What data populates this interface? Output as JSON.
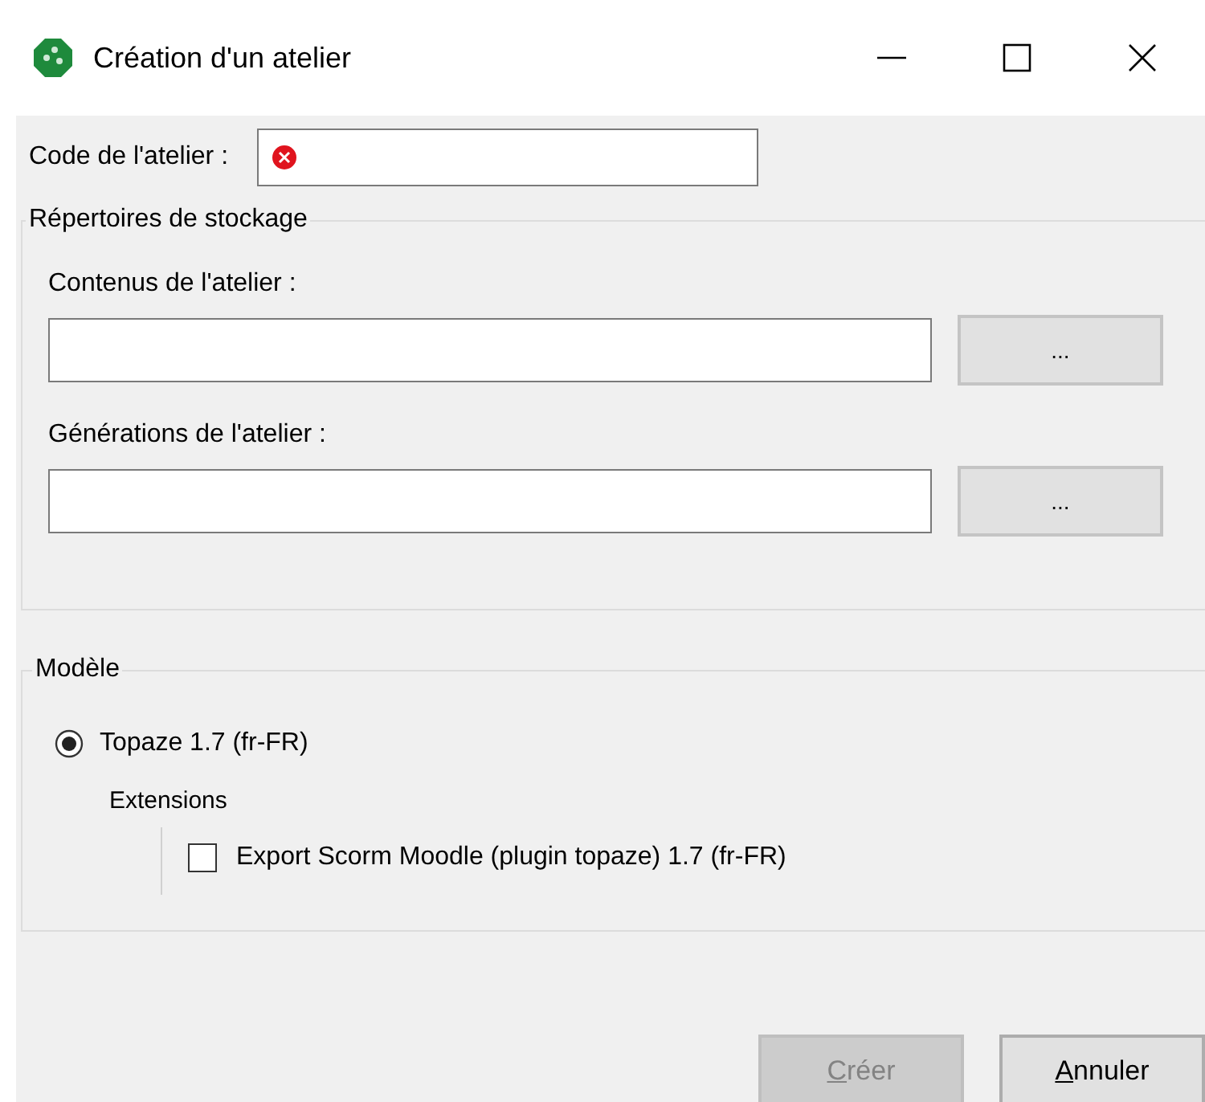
{
  "window": {
    "title": "Création d'un atelier"
  },
  "code_field": {
    "label": "Code de l'atelier :",
    "error": true
  },
  "storage_group": {
    "title": "Répertoires de stockage",
    "folders": [
      {
        "label": "Contenus de l'atelier :",
        "browse": "..."
      },
      {
        "label": "Générations de l'atelier :",
        "browse": "..."
      }
    ]
  },
  "model_group": {
    "title": "Modèle",
    "models": [
      {
        "label": "Topaze 1.7 (fr-FR)",
        "selected": true
      }
    ],
    "extensions_title": "Extensions",
    "extensions": [
      {
        "label": "Export Scorm Moodle (plugin topaze) 1.7 (fr-FR)",
        "checked": false
      }
    ]
  },
  "buttons": [
    {
      "accelerator": "C",
      "rest": "réer",
      "disabled": true
    },
    {
      "accelerator": "A",
      "rest": "nnuler",
      "disabled": false
    }
  ]
}
